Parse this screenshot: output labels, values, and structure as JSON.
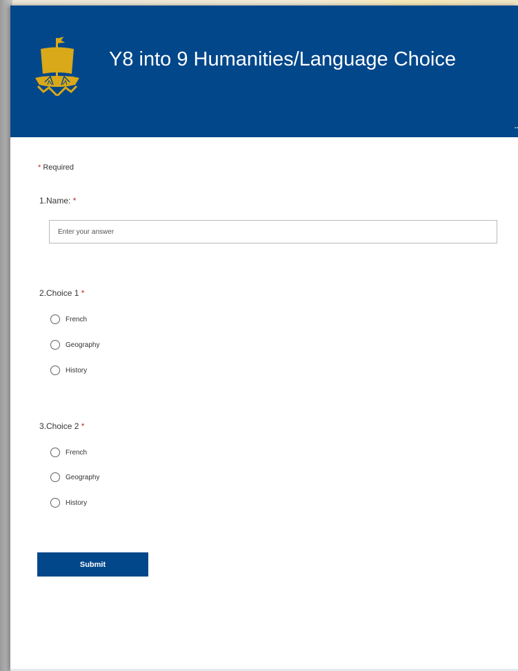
{
  "form": {
    "title": "Y8 into 9 Humanities/Language Choice",
    "header_more": "..",
    "required_star": "*",
    "required_note": "Required",
    "questions": [
      {
        "number": "1.",
        "label": "Name:",
        "star": "*",
        "placeholder": "Enter your answer"
      },
      {
        "number": "2.",
        "label": "Choice 1",
        "star": "*",
        "options": [
          "French",
          "Geography",
          "History"
        ]
      },
      {
        "number": "3.",
        "label": "Choice 2",
        "star": "*",
        "options": [
          "French",
          "Geography",
          "History"
        ]
      }
    ],
    "submit_label": "Submit"
  },
  "colors": {
    "header": "#02478a",
    "logo": "#d9a91a",
    "required_star": "#c4262e"
  },
  "icons": {
    "logo": "ship-logo-icon",
    "radio": "radio-circle-icon"
  }
}
